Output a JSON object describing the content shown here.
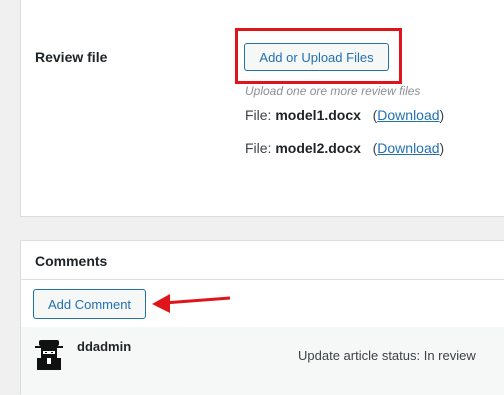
{
  "review": {
    "label": "Review file",
    "upload_button": "Add or Upload Files",
    "hint": "Upload one ore more review files",
    "files": [
      {
        "prefix": "File: ",
        "name": "model1.docx",
        "link": "Download"
      },
      {
        "prefix": "File: ",
        "name": "model2.docx",
        "link": "Download"
      }
    ]
  },
  "comments": {
    "title": "Comments",
    "add_button": "Add Comment",
    "items": [
      {
        "author": "ddadmin",
        "text": "Update article status: In review",
        "avatar_icon": "ninja-avatar-icon"
      }
    ]
  },
  "colors": {
    "accent": "#2271b1",
    "highlight": "#e0151c"
  }
}
